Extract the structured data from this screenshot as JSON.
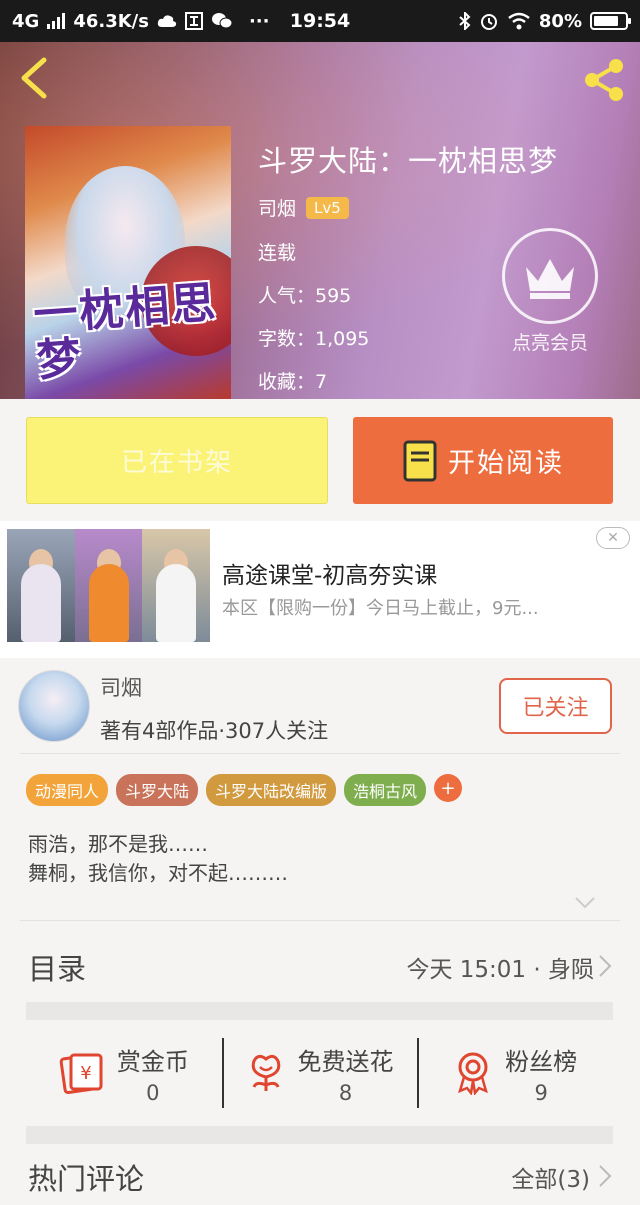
{
  "status_bar": {
    "network": "4G",
    "speed": "46.3K/s",
    "dots": "···",
    "time": "19:54",
    "battery": "80%",
    "battery_level": 0.8
  },
  "book": {
    "title": "斗罗大陆：一枕相思梦",
    "author": "司烟",
    "level": "Lv5",
    "status": "连载",
    "popularity": "人气：595",
    "word_count": "字数：1,095",
    "favorites": "收藏：7",
    "cover_art_text": "一枕相思梦"
  },
  "vip": {
    "label": "点亮会员"
  },
  "actions": {
    "shelf_label": "已在书架",
    "read_label": "开始阅读"
  },
  "ad": {
    "title": "高途课堂-初高夯实课",
    "description": "本区【限购一份】今日马上截止，9元...",
    "close_symbol": "✕"
  },
  "author_info": {
    "name": "司烟",
    "stats": "著有4部作品·307人关注",
    "follow_label": "已关注"
  },
  "tags": [
    {
      "label": "动漫同人",
      "color": "#f2a43a"
    },
    {
      "label": "斗罗大陆",
      "color": "#c9745a"
    },
    {
      "label": "斗罗大陆改编版",
      "color": "#d19a3f"
    },
    {
      "label": "浩桐古风",
      "color": "#7fae4e"
    }
  ],
  "tag_add_symbol": "+",
  "synopsis": "雨浩，那不是我……\n舞桐，我信你，对不起………",
  "catalog": {
    "title": "目录",
    "update": "今天 15:01 · 身陨"
  },
  "stats": [
    {
      "label": "赏金币",
      "value": "0",
      "icon": "red-envelope-icon"
    },
    {
      "label": "免费送花",
      "value": "8",
      "icon": "flower-icon"
    },
    {
      "label": "粉丝榜",
      "value": "9",
      "icon": "medal-icon"
    }
  ],
  "comments": {
    "title": "热门评论",
    "all_label": "全部(3)"
  },
  "colors": {
    "accent": "#ee6d3e",
    "shelf_button": "#fbf378",
    "follow_border": "#e0654a"
  }
}
